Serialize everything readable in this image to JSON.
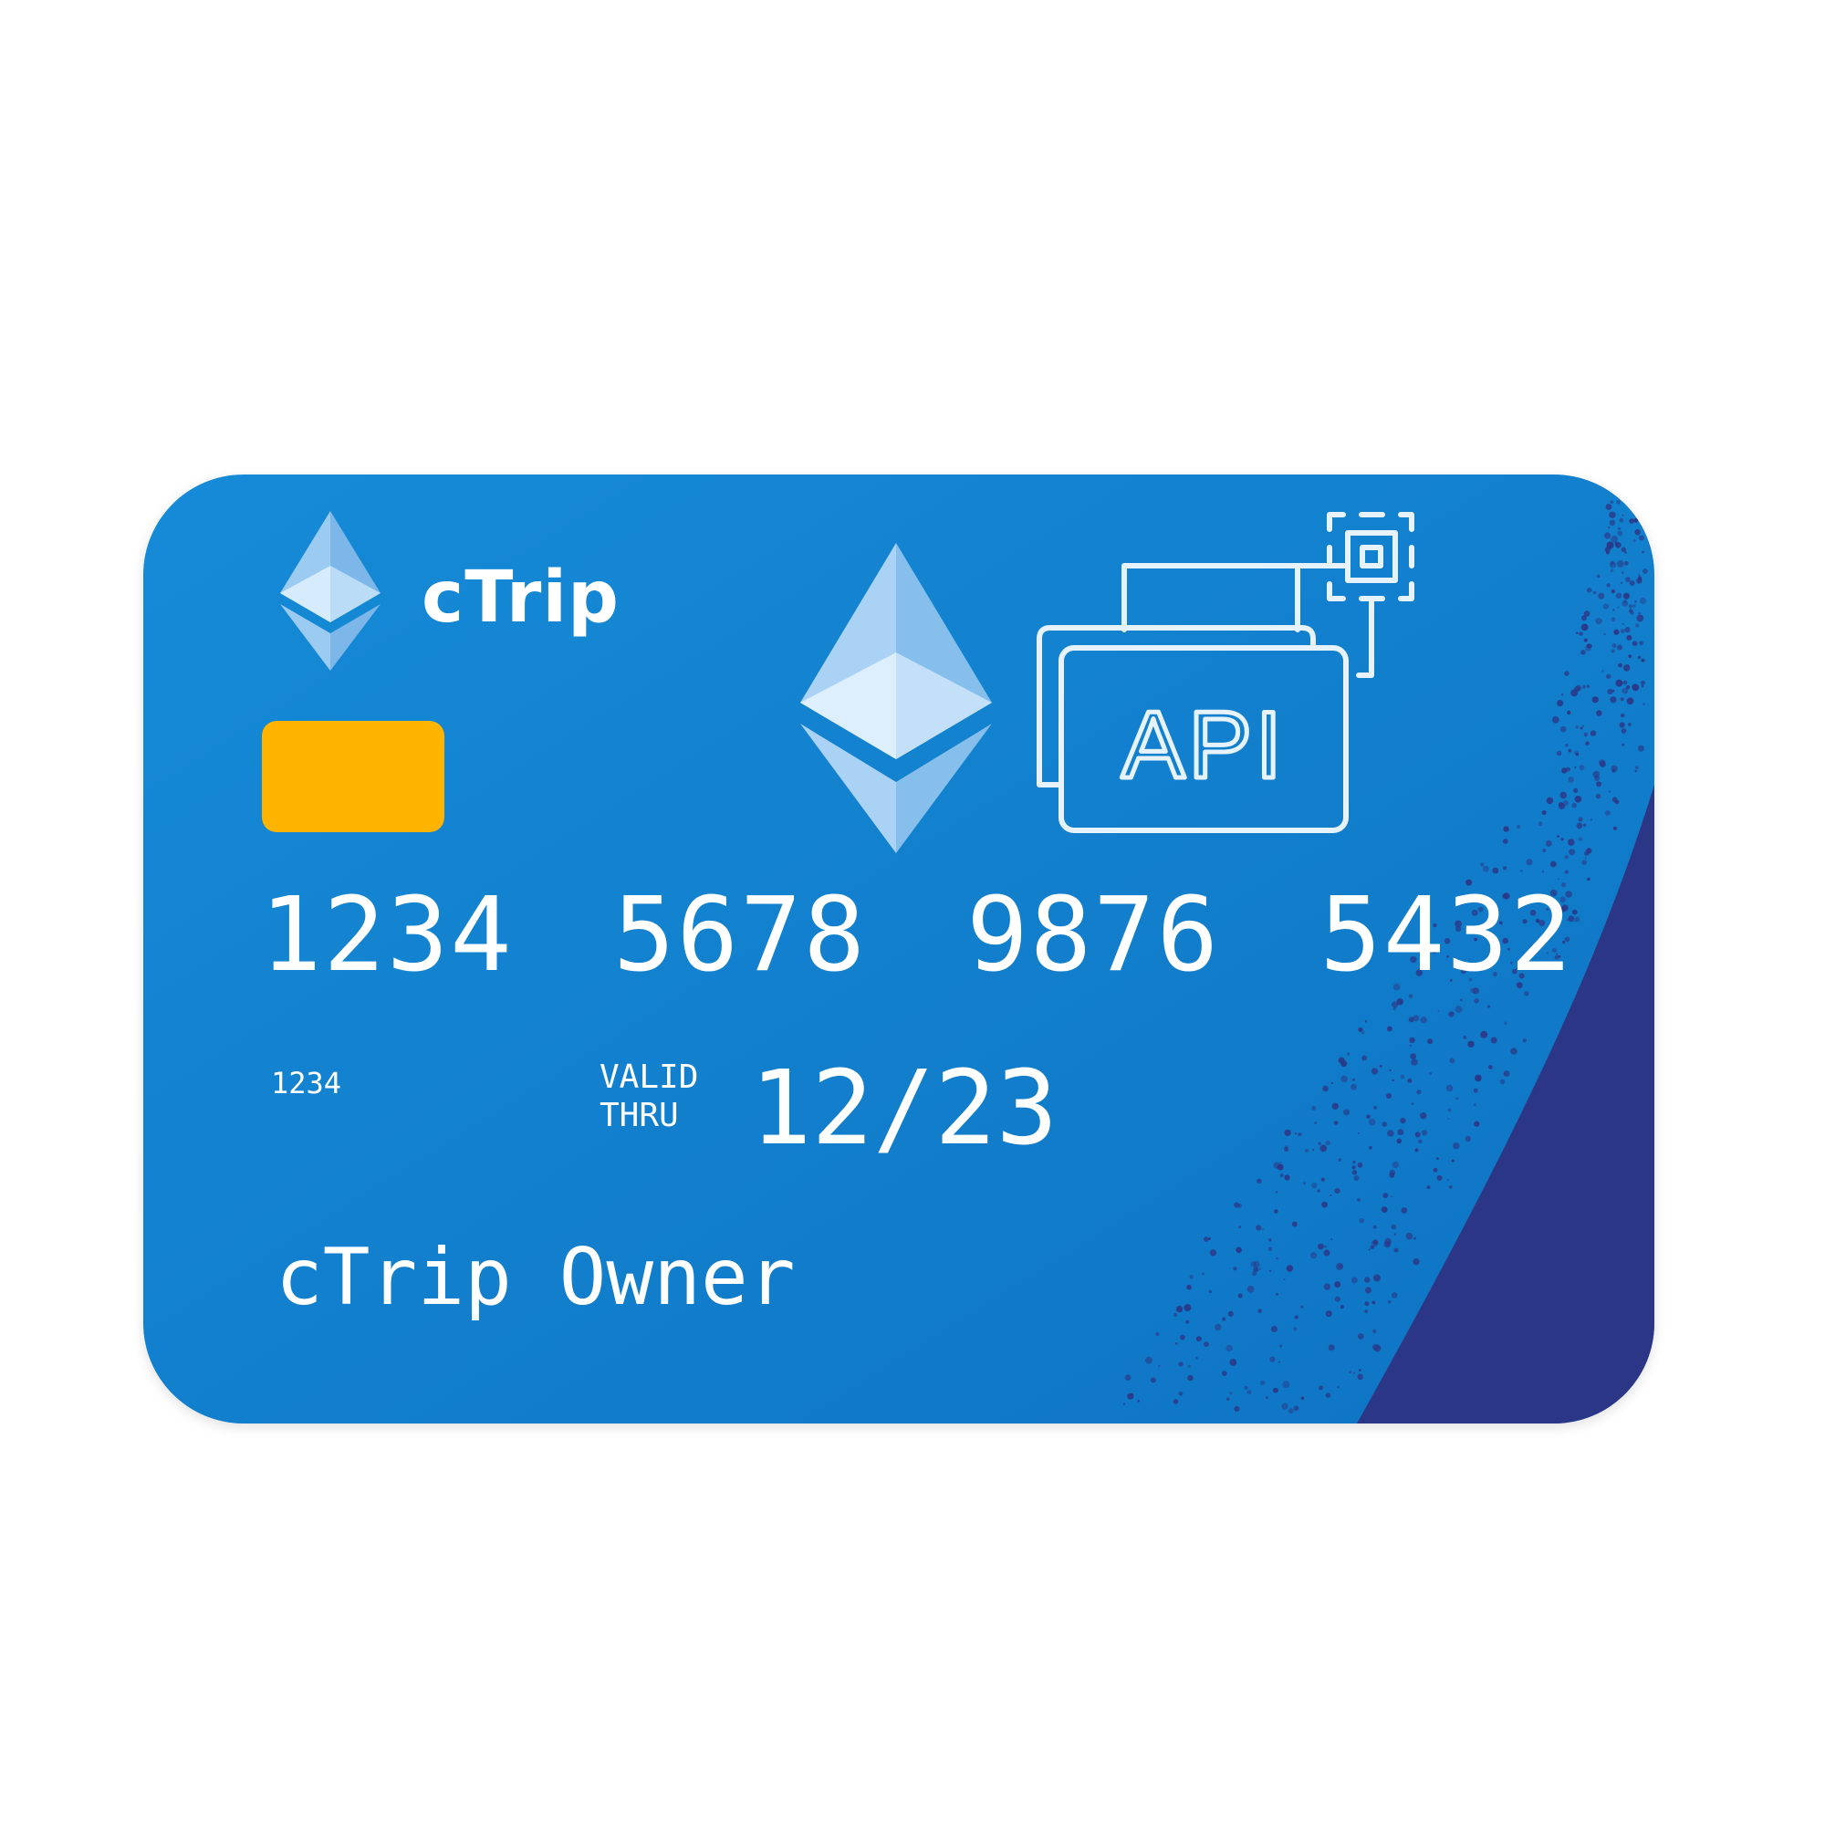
{
  "card": {
    "brand_name": "cTrip",
    "number_groups": [
      "1234",
      "5678",
      "9876",
      "5432"
    ],
    "number": "1234 5678 9876 5432",
    "small_code": "1234",
    "valid_label_line1": "VALID",
    "valid_label_line2": "THRU",
    "expiry": "12/23",
    "holder_name": "cTrip Owner",
    "api_label": "API"
  },
  "icons": {
    "brand_logo": "ethereum-icon",
    "center_logo": "ethereum-icon",
    "api": "api-cards-icon",
    "chip": "card-chip"
  },
  "colors": {
    "card_blue": "#1585D2",
    "card_blue_dark": "#0F76C4",
    "corner_navy": "#2B3786",
    "chip_gold": "#FFB400",
    "text": "#FFFFFF",
    "eth_light": "#CFE6FA",
    "eth_mid": "#9CCBF2"
  }
}
